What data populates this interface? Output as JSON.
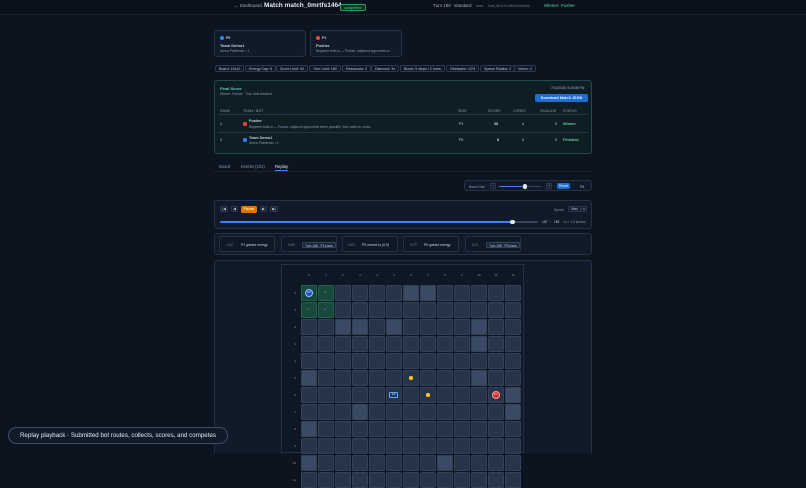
{
  "topbar": {
    "back": "← Dashboard",
    "title": "Match match_0mrtfs1464...",
    "status": "completed",
    "turn": "Turn 180",
    "mode": "standard",
    "seed_label": "seed",
    "seed": "0mrt_8d117c2d5c31f4e4a9b",
    "winner": "Winner: Pusher"
  },
  "players": [
    {
      "tag": "P0",
      "name": "Team Demo1",
      "desc": "Arena Pathfinder • 1",
      "color": "#3b82f6"
    },
    {
      "tag": "P1",
      "name": "Pusher",
      "desc": "Beginner built-in — Pusher: adjacent opponents w...",
      "color": "#ef4444"
    }
  ],
  "chips": [
    "Board: 15x12",
    "Energy Cap: 8",
    "Score Limit: 50",
    "Turn Limit: 180",
    "Resources: 2",
    "Diamond: 3x",
    "Boost: 5 steps / 2 turns",
    "Obstacles: 12%",
    "Spawn Radius: 2",
    "Vision: 4"
  ],
  "final": {
    "title": "Final Score",
    "summary": "Winner: Pusher · Turn limit reached",
    "timestamp": "7/10/2026, 9:28:36 PM",
    "download": "Download Match JSON",
    "headers": [
      "RANK",
      "TEAM / BOT",
      "SEAT",
      "SCORE",
      "CORES",
      "INVALIDS",
      "STATUS"
    ],
    "rows": [
      {
        "rank": "1",
        "team": "Pusher",
        "desc": "Beginner built-in — Pusher: adjacent opponents when possible, then walk for cores.",
        "seat": "P1",
        "score": "38",
        "cores": "4",
        "invalids": "0",
        "status": "Winner",
        "color": "#ef4444"
      },
      {
        "rank": "2",
        "team": "Team Demo1",
        "desc": "Arena Pathfinder • 1",
        "seat": "P0",
        "score": "8",
        "cores": "0",
        "invalids": "0",
        "status": "Finished",
        "color": "#3b82f6"
      }
    ]
  },
  "tabs": [
    "Board",
    "Events (101)",
    "Replay"
  ],
  "board_size": {
    "label": "Board Size",
    "minus": "−",
    "plus": "+",
    "reset": "Reset",
    "fit": "Fit",
    "value": 0.62
  },
  "replay": {
    "first": "|◀",
    "prev": "◀",
    "pause": "Pause",
    "next": "▶",
    "last": "▶|",
    "speed_label": "Speed",
    "speed": "Max",
    "frame": "167",
    "total": "181",
    "note": "1x = 1.5 turns/s",
    "progress": 0.92
  },
  "events": [
    {
      "turn": "t167",
      "text": "P1 gained energy",
      "boxed": false
    },
    {
      "turn": "t168",
      "text": "Turn 168 · P1's turn",
      "boxed": true
    },
    {
      "turn": "t169",
      "text": "P0 moved to (0,9)",
      "boxed": false
    },
    {
      "turn": "t170",
      "text": "P0 gained energy",
      "boxed": false
    },
    {
      "turn": "t171",
      "text": "Turn 169 · P0's turn",
      "boxed": true
    }
  ],
  "grid": {
    "cols": [
      "0",
      "1",
      "2",
      "3",
      "4",
      "5",
      "6",
      "7",
      "8",
      "9",
      "10",
      "11",
      "12"
    ],
    "rows": [
      "0",
      "1",
      "2",
      "3",
      "4",
      "5",
      "6",
      "7",
      "8",
      "9",
      "10",
      "11"
    ],
    "p0": "P0",
    "p1": "P1",
    "box": "1/2"
  },
  "toast": "Replay playback · Submitted bot routes, collects, scores, and competes"
}
